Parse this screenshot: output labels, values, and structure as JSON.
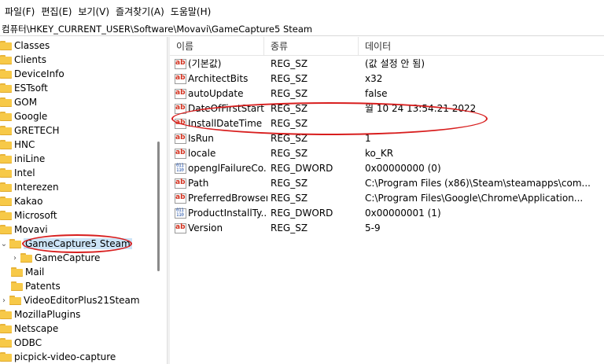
{
  "menu": [
    "파일(F)",
    "편집(E)",
    "보기(V)",
    "즐겨찾기(A)",
    "도움말(H)"
  ],
  "address": "컴퓨터\\HKEY_CURRENT_USER\\Software\\Movavi\\GameCapture5 Steam",
  "tree": [
    {
      "label": "Classes"
    },
    {
      "label": "Clients"
    },
    {
      "label": "DeviceInfo"
    },
    {
      "label": "ESTsoft"
    },
    {
      "label": "GOM"
    },
    {
      "label": "Google"
    },
    {
      "label": "GRETECH"
    },
    {
      "label": "HNC"
    },
    {
      "label": "iniLine"
    },
    {
      "label": "Intel"
    },
    {
      "label": "Interezen"
    },
    {
      "label": "Kakao"
    },
    {
      "label": "Microsoft"
    },
    {
      "label": "Movavi"
    },
    {
      "label": "GameCapture5 Steam"
    },
    {
      "label": "GameCapture"
    },
    {
      "label": "Mail"
    },
    {
      "label": "Patents"
    },
    {
      "label": "VideoEditorPlus21Steam"
    },
    {
      "label": "MozillaPlugins"
    },
    {
      "label": "Netscape"
    },
    {
      "label": "ODBC"
    },
    {
      "label": "picpick-video-capture"
    }
  ],
  "columns": {
    "name": "이름",
    "type": "종류",
    "data": "데이터"
  },
  "values": [
    {
      "icon": "string-value-icon",
      "name": "(기본값)",
      "type": "REG_SZ",
      "data": "(값 설정 안 됨)"
    },
    {
      "icon": "string-value-icon",
      "name": "ArchitectBits",
      "type": "REG_SZ",
      "data": "x32"
    },
    {
      "icon": "string-value-icon",
      "name": "autoUpdate",
      "type": "REG_SZ",
      "data": "false"
    },
    {
      "icon": "string-value-icon",
      "name": "DateOfFirstStart",
      "type": "REG_SZ",
      "data": "월 10 24 13:54:21 2022"
    },
    {
      "icon": "string-value-icon",
      "name": "InstallDateTime",
      "type": "REG_SZ",
      "data": ""
    },
    {
      "icon": "string-value-icon",
      "name": "IsRun",
      "type": "REG_SZ",
      "data": "1"
    },
    {
      "icon": "string-value-icon",
      "name": "locale",
      "type": "REG_SZ",
      "data": "ko_KR"
    },
    {
      "icon": "binary-value-icon",
      "name": "openglFailureCo...",
      "type": "REG_DWORD",
      "data": "0x00000000 (0)"
    },
    {
      "icon": "string-value-icon",
      "name": "Path",
      "type": "REG_SZ",
      "data": "C:\\Program Files (x86)\\Steam\\steamapps\\com..."
    },
    {
      "icon": "string-value-icon",
      "name": "PreferredBrowser",
      "type": "REG_SZ",
      "data": "C:\\Program Files\\Google\\Chrome\\Application..."
    },
    {
      "icon": "binary-value-icon",
      "name": "ProductInstallTy...",
      "type": "REG_DWORD",
      "data": "0x00000001 (1)"
    },
    {
      "icon": "string-value-icon",
      "name": "Version",
      "type": "REG_SZ",
      "data": "5-9"
    }
  ],
  "colors": {
    "annotation": "#d81e1e",
    "folder": "#f7c948",
    "selection": "#cce4f7"
  }
}
